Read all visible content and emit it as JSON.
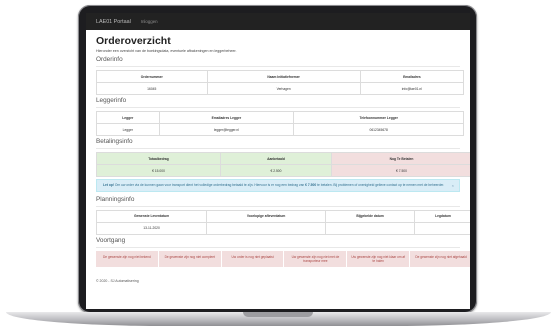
{
  "navbar": {
    "brand": "LAE01 Portaal",
    "link": "Inloggen"
  },
  "page": {
    "title": "Orderoverzicht",
    "intro": "Hieronder een overzicht van de boekingsdata, eventuele afbakeningen en leggerbeheer."
  },
  "orderinfo": {
    "heading": "Orderinfo",
    "headers": [
      "Ordernummer",
      "Naam Initiatiefnemer",
      "Emailadres"
    ],
    "values": [
      "16045",
      "Verhagen",
      "info@lae01.nl"
    ]
  },
  "leggerinfo": {
    "heading": "Leggerinfo",
    "headers": [
      "Legger",
      "Emailadres Legger",
      "Telefoonnummer Legger"
    ],
    "values": [
      "Legger",
      "legger@legger.nl",
      "0612345678"
    ]
  },
  "betalingsinfo": {
    "heading": "Betalingsinfo",
    "headers": [
      "Totaalbedrag",
      "Aanbetaald",
      "Nog Te Betalen"
    ],
    "values": [
      "€ 15.000",
      "€ 2.500",
      "€ 7.500"
    ],
    "alert": {
      "bold": "Let op!",
      "text1": "Om uw order via de kunnen gaan voor transport dient het volledige orderbedrag betaald te zijn. Hiervoor is er nog een bedrag van",
      "amount": "€ 7.500",
      "text2": "te betalen. Bij problemen of onenigheid gelieve contact op te nemen met de beheerder.",
      "close": "×"
    }
  },
  "planninginfo": {
    "heading": "Planningsinfo",
    "headers": [
      "Gewenste Leverdatum",
      "Voorlopige afleverdatum",
      "Bijgebelde datum",
      "Legdatum"
    ],
    "values": [
      "13-11-2020",
      "",
      "",
      ""
    ]
  },
  "voortgang": {
    "heading": "Voortgang",
    "items": [
      "De gewenste zijn nog niet bekend",
      "De gewenste zijn nog niet compleet",
      "Uw order is nog niet geplaatst",
      "Uw gewenste zijn nog niet met de transporteur mee",
      "Uw gewenste zijn nog niet klaar om af te halen",
      "De gewenste zijn nog niet afgehaald"
    ]
  },
  "footer": {
    "text": "© 2020 - SJ Automatisering"
  },
  "colors": {
    "navbar": "#222222",
    "success_bg": "#dff0d8",
    "danger_bg": "#f2dede",
    "info_bg": "#d9edf7"
  }
}
